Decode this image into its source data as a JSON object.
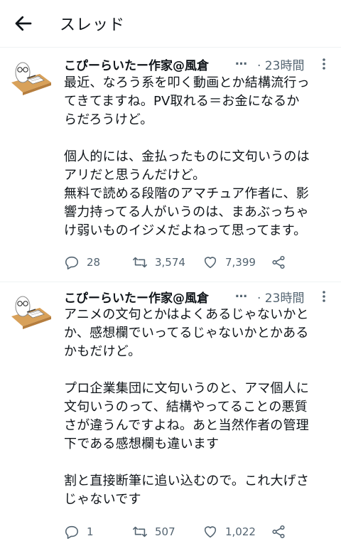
{
  "header": {
    "title": "スレッド"
  },
  "tweets": [
    {
      "name": "こぴーらいたー作家@風倉",
      "ellipsis": "…",
      "time": "· 23時間",
      "text": "最近、なろう系を叩く動画とか結構流行っ\nてきてますね。PV取れる＝お金になるか\nらだろうけど。\n\n個人的には、金払ったものに文句いうのは\nアリだと思うんだけど。\n無料で読める段階のアマチュア作者に、影\n響力持ってる人がいうのは、まあぶっちゃ\nけ弱いものイジメだよねって思ってます。",
      "replies": "28",
      "retweets": "3,574",
      "likes": "7,399"
    },
    {
      "name": "こぴーらいたー作家@風倉",
      "ellipsis": "…",
      "time": "· 23時間",
      "text": "アニメの文句とかはよくあるじゃないかと\nか、感想欄でいってるじゃないかとかある\nかもだけど。\n\nプロ企業集団に文句いうのと、アマ個人に\n文句いうのって、結構やってることの悪質\nさが違うんですよね。あと当然作者の管理\n下である感想欄も違います\n\n割と直接断筆に追い込むので。これ大げさ\nじゃないです",
      "replies": "1",
      "retweets": "507",
      "likes": "1,022"
    }
  ],
  "colors": {
    "text": "#0f1419",
    "secondary": "#536471",
    "divider": "#eff3f4",
    "desk": "#d8a15a"
  },
  "icons": [
    "back-arrow-icon",
    "more-icon",
    "reply-icon",
    "retweet-icon",
    "like-icon",
    "share-icon"
  ]
}
